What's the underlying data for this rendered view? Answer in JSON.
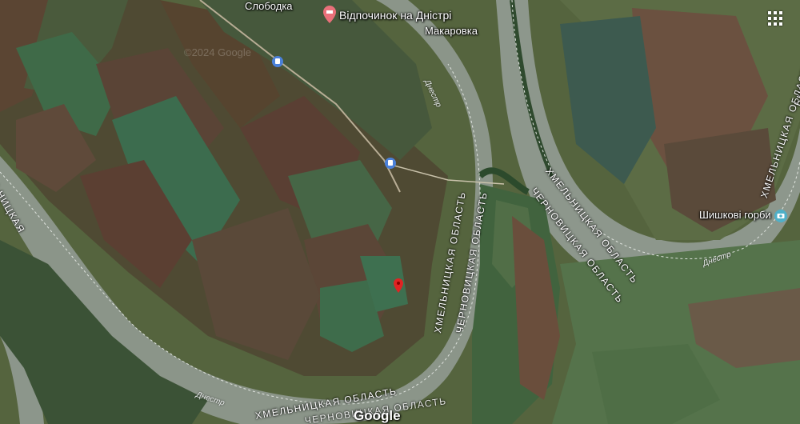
{
  "map": {
    "type": "satellite",
    "colors": {
      "water": "#8e998f",
      "field_dark": "#5a4734",
      "field_green": "#3f6a44",
      "forest": "#2c4a2c",
      "road": "#b9b09a"
    }
  },
  "places": {
    "slobodka": "Слободка",
    "resort": "Відпочинок на Дністрі",
    "makarovka": "Макаровка",
    "shishkovi": "Шишкові горби"
  },
  "rivers": {
    "top": "Днестр",
    "right": "Днестр",
    "bottom": "Днестр"
  },
  "regions": {
    "khm_left": "ХМЕЛЬНИЦКАЯ ОБЛАСТЬ",
    "cher_left": "ЧЕРНОВИЦКАЯ ОБЛАСТЬ",
    "khm_mid": "ХМЕЛЬНИЦКАЯ ОБЛАСТЬ",
    "cher_mid": "ЧЕРНОВИЦКАЯ ОБЛАСТЬ",
    "khm_right": "ХМЕЛЬНИЦКАЯ ОБЛАСТЬ",
    "khm_bottom": "ХМЕЛЬНИЦКАЯ ОБЛАСТЬ",
    "cher_bottom": "ЧЕРНОВИЦКАЯ ОБЛАСТЬ",
    "edge_left": "ЬНИЦКАЯ",
    "edge_right": "ЬНИЦ"
  },
  "watermark": "©2024 Google",
  "logo": "Google",
  "icons": {
    "resort": "hotel-pin-icon",
    "bus1": "bus-stop-icon",
    "bus2": "bus-stop-icon",
    "marker": "red-location-pin-icon",
    "camera": "photo-camera-icon",
    "apps": "grid-apps-icon"
  }
}
